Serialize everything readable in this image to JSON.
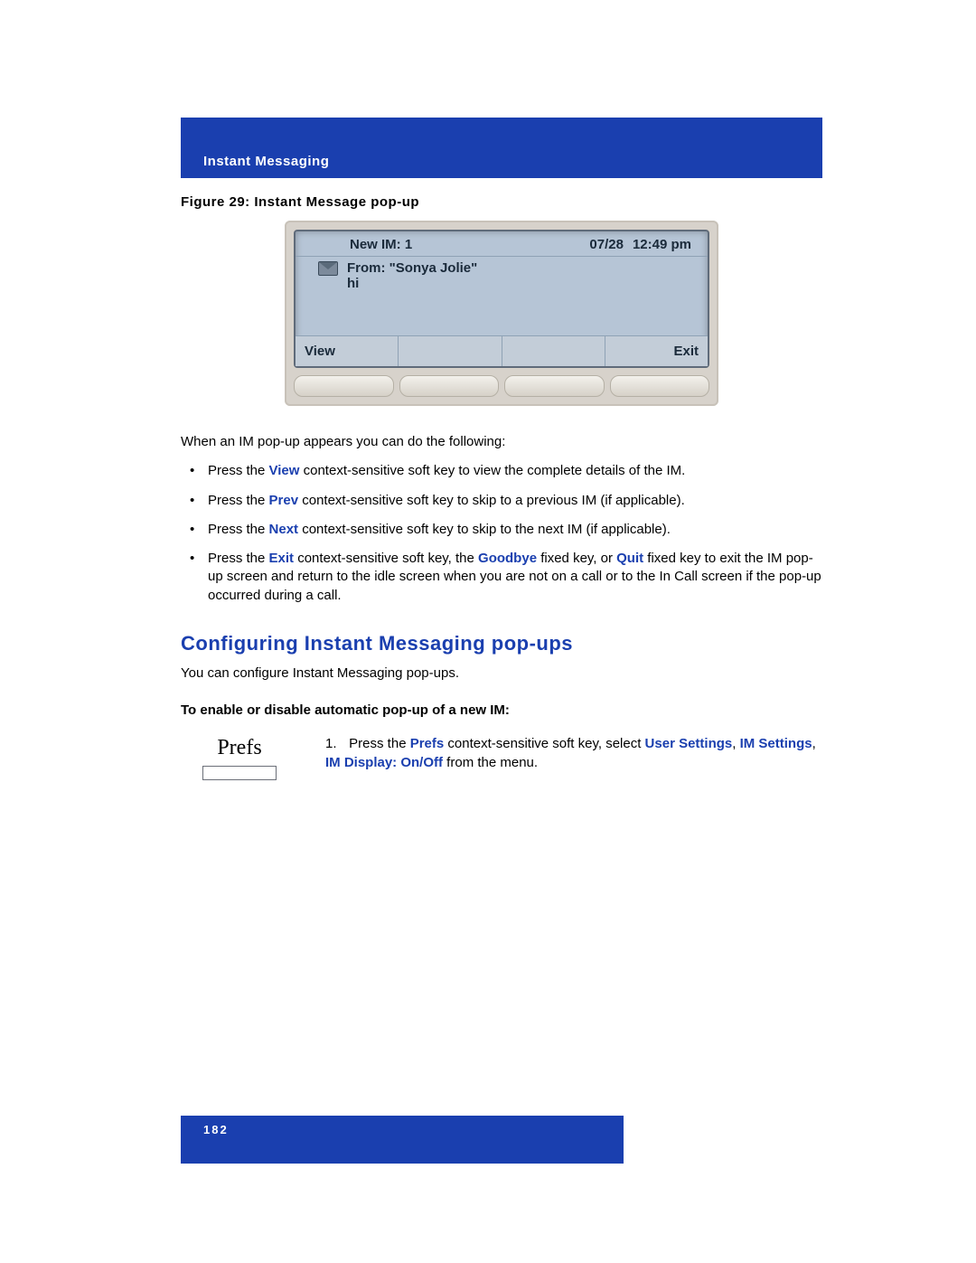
{
  "header": {
    "section": "Instant Messaging"
  },
  "figure": {
    "caption": "Figure 29: Instant Message pop-up",
    "screen": {
      "new_im_label": "New IM: 1",
      "date": "07/28",
      "time": "12:49 pm",
      "from_line": "From: \"Sonya Jolie\"",
      "message_line": "hi",
      "softkey_left": "View",
      "softkey_right": "Exit"
    }
  },
  "intro": "When an IM pop-up appears you can do the following:",
  "bullets": [
    {
      "pre": "Press the ",
      "kw": "View",
      "post": " context-sensitive soft key to view the complete details of the IM."
    },
    {
      "pre": "Press the ",
      "kw": "Prev",
      "post": " context-sensitive soft key to skip to a previous IM (if applicable)."
    },
    {
      "pre": "Press the ",
      "kw": "Next",
      "post": " context-sensitive soft key to skip to the next IM (if applicable)."
    }
  ],
  "bullet4": {
    "p1": "Press the ",
    "kw_exit": "Exit",
    "p2": " context-sensitive soft key, the ",
    "kw_goodbye": "Goodbye",
    "p3": " fixed key, or ",
    "kw_quit": "Quit",
    "p4": " fixed key to exit the IM pop-up screen and return to the idle screen when you are not on a call or to the In Call screen if the pop-up occurred during a call."
  },
  "section_heading": "Configuring Instant Messaging pop-ups",
  "section_intro": "You can configure Instant Messaging pop-ups.",
  "enable_line": "To enable or disable automatic pop-up of a new IM:",
  "prefs_label": "Prefs",
  "step1": {
    "num": "1.",
    "p1": "Press the ",
    "kw_prefs": "Prefs",
    "p2": " context-sensitive soft key, select ",
    "kw_us": "User Settings",
    "comma1": ", ",
    "kw_im": "IM Settings",
    "comma2": ", ",
    "kw_disp": "IM Display: On/Off",
    "p3": " from the menu."
  },
  "page_number": "182"
}
